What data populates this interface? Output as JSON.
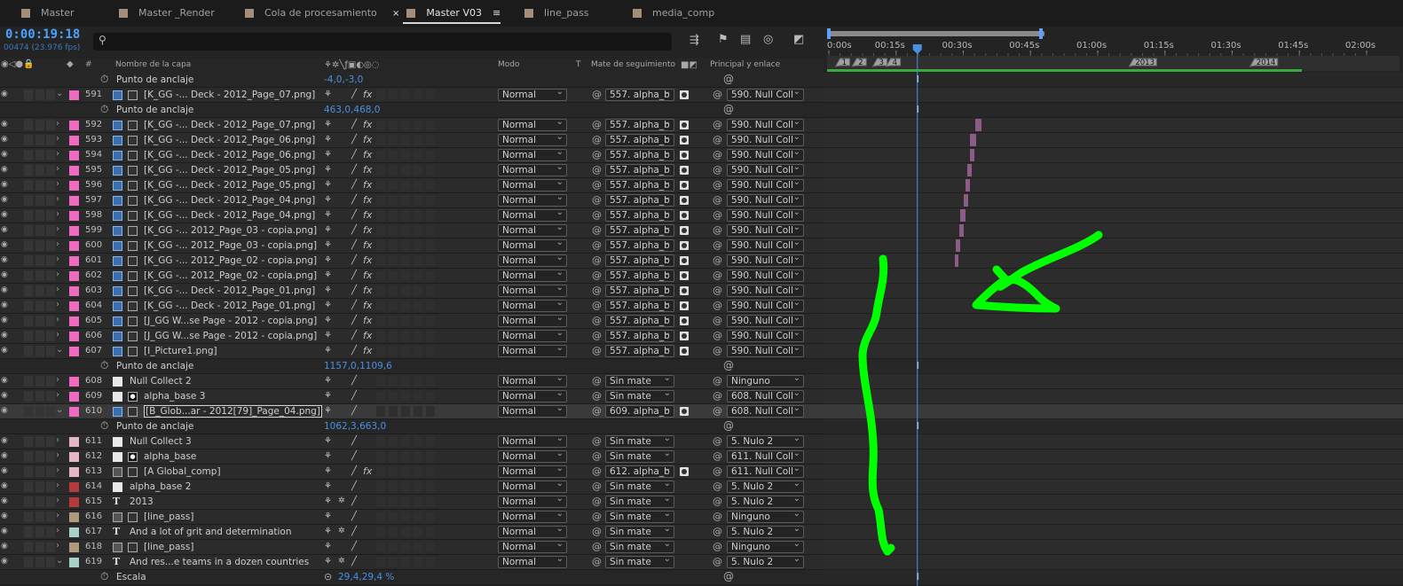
{
  "tabs": [
    {
      "label": "Master",
      "closeable": false
    },
    {
      "label": "Master _Render",
      "closeable": false
    },
    {
      "label": "Cola de procesamiento",
      "closeable": false
    },
    {
      "label": "Master V03",
      "closeable": true,
      "active": true
    },
    {
      "label": "line_pass",
      "closeable": false
    },
    {
      "label": "media_comp",
      "closeable": false
    }
  ],
  "header": {
    "timecode": "0:00:19:18",
    "frames": "00474 (23.976 fps)"
  },
  "columns": {
    "layer_name": "Nombre de la capa",
    "mode": "Modo",
    "t": "T",
    "track_matte": "Mate de seguimiento",
    "parent": "Principal y enlace",
    "hash": "#"
  },
  "rows": [
    {
      "kind": "prop",
      "name": "Punto de anclaje",
      "value": "-4,0,-3,0"
    },
    {
      "kind": "layer",
      "num": "591",
      "label": "#f06ac1",
      "type": "img",
      "name": "[K_GG -... Deck - 2012_Page_07.png]",
      "expanded": true,
      "mode": "Normal",
      "matte": "557. alpha_b",
      "parent": "590. Null Coll",
      "fx": true
    },
    {
      "kind": "prop",
      "name": "Punto de anclaje",
      "value": "463,0,468,0"
    },
    {
      "kind": "layer",
      "num": "592",
      "label": "#f06ac1",
      "type": "img",
      "name": "[K_GG -... Deck - 2012_Page_07.png]",
      "mode": "Normal",
      "matte": "557. alpha_b",
      "parent": "590. Null Coll",
      "fx": true
    },
    {
      "kind": "layer",
      "num": "593",
      "label": "#f06ac1",
      "type": "img",
      "name": "[K_GG -... Deck - 2012_Page_06.png]",
      "mode": "Normal",
      "matte": "557. alpha_b",
      "parent": "590. Null Coll",
      "fx": true
    },
    {
      "kind": "layer",
      "num": "594",
      "label": "#f06ac1",
      "type": "img",
      "name": "[K_GG -... Deck - 2012_Page_06.png]",
      "mode": "Normal",
      "matte": "557. alpha_b",
      "parent": "590. Null Coll",
      "fx": true
    },
    {
      "kind": "layer",
      "num": "595",
      "label": "#f06ac1",
      "type": "img",
      "name": "[K_GG -... Deck - 2012_Page_05.png]",
      "mode": "Normal",
      "matte": "557. alpha_b",
      "parent": "590. Null Coll",
      "fx": true
    },
    {
      "kind": "layer",
      "num": "596",
      "label": "#f06ac1",
      "type": "img",
      "name": "[K_GG -... Deck - 2012_Page_05.png]",
      "mode": "Normal",
      "matte": "557. alpha_b",
      "parent": "590. Null Coll",
      "fx": true
    },
    {
      "kind": "layer",
      "num": "597",
      "label": "#f06ac1",
      "type": "img",
      "name": "[K_GG -... Deck - 2012_Page_04.png]",
      "mode": "Normal",
      "matte": "557. alpha_b",
      "parent": "590. Null Coll",
      "fx": true
    },
    {
      "kind": "layer",
      "num": "598",
      "label": "#f06ac1",
      "type": "img",
      "name": "[K_GG -... Deck - 2012_Page_04.png]",
      "mode": "Normal",
      "matte": "557. alpha_b",
      "parent": "590. Null Coll",
      "fx": true
    },
    {
      "kind": "layer",
      "num": "599",
      "label": "#f06ac1",
      "type": "img",
      "name": "[K_GG -... 2012_Page_03 - copia.png]",
      "mode": "Normal",
      "matte": "557. alpha_b",
      "parent": "590. Null Coll",
      "fx": true
    },
    {
      "kind": "layer",
      "num": "600",
      "label": "#f06ac1",
      "type": "img",
      "name": "[K_GG -... 2012_Page_03 - copia.png]",
      "mode": "Normal",
      "matte": "557. alpha_b",
      "parent": "590. Null Coll",
      "fx": true
    },
    {
      "kind": "layer",
      "num": "601",
      "label": "#f06ac1",
      "type": "img",
      "name": "[K_GG -... 2012_Page_02 - copia.png]",
      "mode": "Normal",
      "matte": "557. alpha_b",
      "parent": "590. Null Coll",
      "fx": true
    },
    {
      "kind": "layer",
      "num": "602",
      "label": "#f06ac1",
      "type": "img",
      "name": "[K_GG -... 2012_Page_02 - copia.png]",
      "mode": "Normal",
      "matte": "557. alpha_b",
      "parent": "590. Null Coll",
      "fx": true
    },
    {
      "kind": "layer",
      "num": "603",
      "label": "#f06ac1",
      "type": "img",
      "name": "[K_GG -... Deck - 2012_Page_01.png]",
      "mode": "Normal",
      "matte": "557. alpha_b",
      "parent": "590. Null Coll",
      "fx": true
    },
    {
      "kind": "layer",
      "num": "604",
      "label": "#f06ac1",
      "type": "img",
      "name": "[K_GG -... Deck - 2012_Page_01.png]",
      "mode": "Normal",
      "matte": "557. alpha_b",
      "parent": "590. Null Coll",
      "fx": true
    },
    {
      "kind": "layer",
      "num": "605",
      "label": "#f06ac1",
      "type": "img",
      "name": "[J_GG W...se Page - 2012 - copia.png]",
      "mode": "Normal",
      "matte": "557. alpha_b",
      "parent": "590. Null Coll",
      "fx": true
    },
    {
      "kind": "layer",
      "num": "606",
      "label": "#f06ac1",
      "type": "img",
      "name": "[J_GG W...se Page - 2012 - copia.png]",
      "mode": "Normal",
      "matte": "557. alpha_b",
      "parent": "590. Null Coll",
      "fx": true
    },
    {
      "kind": "layer",
      "num": "607",
      "label": "#f06ac1",
      "type": "img",
      "name": "[I_Picture1.png]",
      "expanded": true,
      "mode": "Normal",
      "matte": "557. alpha_b",
      "parent": "590. Null Coll",
      "fx": true
    },
    {
      "kind": "prop",
      "name": "Punto de anclaje",
      "value": "1157,0,1109,6"
    },
    {
      "kind": "layer",
      "num": "608",
      "label": "#f06ac1",
      "type": "solid",
      "name": "Null Collect  2",
      "mode": "Normal",
      "matte": "Sin mate",
      "parent": "Ninguno"
    },
    {
      "kind": "layer",
      "num": "609",
      "label": "#f06ac1",
      "type": "solid2",
      "name": "alpha_base 3",
      "mode": "Normal",
      "matte": "Sin mate",
      "parent": "608. Null Coll"
    },
    {
      "kind": "layer",
      "num": "610",
      "label": "#f06ac1",
      "type": "img",
      "name": "[B_Glob...ar - 2012[79]_Page_04.png]",
      "expanded": true,
      "selected": true,
      "mode": "Normal",
      "matte": "609. alpha_b",
      "parent": "608. Null Coll"
    },
    {
      "kind": "prop",
      "name": "Punto de anclaje",
      "value": "1062,3,663,0"
    },
    {
      "kind": "layer",
      "num": "611",
      "label": "#e7b6c3",
      "type": "solid",
      "name": "Null Collect  3",
      "mode": "Normal",
      "matte": "Sin mate",
      "parent": "5. Nulo 2"
    },
    {
      "kind": "layer",
      "num": "612",
      "label": "#e7b6c3",
      "type": "solid2",
      "name": "alpha_base",
      "mode": "Normal",
      "matte": "Sin mate",
      "parent": "611. Null Coll"
    },
    {
      "kind": "layer",
      "num": "613",
      "label": "#e7b6c3",
      "type": "comp",
      "name": "[A Global_comp]",
      "mode": "Normal",
      "matte": "612. alpha_b",
      "parent": "611. Null Coll",
      "fx": true
    },
    {
      "kind": "layer",
      "num": "614",
      "label": "#b53a3a",
      "type": "solid",
      "name": "alpha_base 2",
      "mode": "Normal",
      "matte": "Sin mate",
      "parent": "5. Nulo 2"
    },
    {
      "kind": "layer",
      "num": "615",
      "label": "#b53a3a",
      "type": "text",
      "name": "2013",
      "mode": "Normal",
      "matte": "Sin mate",
      "parent": "5. Nulo 2"
    },
    {
      "kind": "layer",
      "num": "616",
      "label": "#b09a7e",
      "type": "comp",
      "name": "[line_pass]",
      "mode": "Normal",
      "matte": "Sin mate",
      "parent": "Ninguno"
    },
    {
      "kind": "layer",
      "num": "617",
      "label": "#a8d1c7",
      "type": "text",
      "name": "And a lot  of grit and determination",
      "mode": "Normal",
      "matte": "Sin mate",
      "parent": "5. Nulo 2"
    },
    {
      "kind": "layer",
      "num": "618",
      "label": "#b09a7e",
      "type": "comp",
      "name": "[line_pass]",
      "mode": "Normal",
      "matte": "Sin mate",
      "parent": "Ninguno"
    },
    {
      "kind": "layer",
      "num": "619",
      "label": "#a8d1c7",
      "type": "text",
      "name": "And res...e  teams in a  dozen  countries",
      "expanded": true,
      "mode": "Normal",
      "matte": "Sin mate",
      "parent": "5. Nulo 2"
    },
    {
      "kind": "prop",
      "name": "Escala",
      "value": "29,4,29,4 %",
      "link": true
    }
  ],
  "timeline": {
    "ruler_labels": [
      "0:00s",
      "00:15s",
      "00:30s",
      "00:45s",
      "01:00s",
      "01:15s",
      "01:30s",
      "01:45s",
      "02:00s"
    ],
    "markers": [
      "1",
      "2",
      "3",
      "4",
      "2013",
      "2014"
    ],
    "current_time_s": 19.75,
    "duration_s": 120,
    "accent": "#4a90e2",
    "annotation_color": "#00ff00"
  }
}
